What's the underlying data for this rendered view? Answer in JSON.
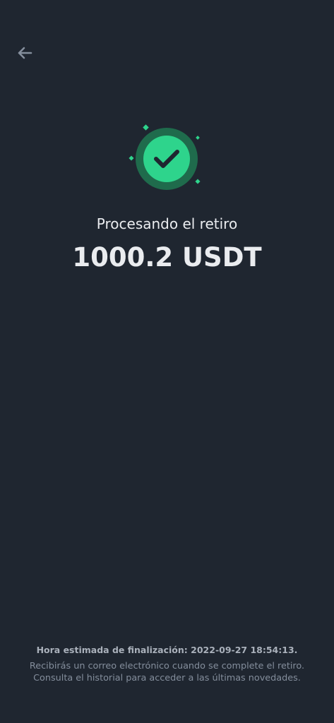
{
  "header": {
    "back_icon": "arrow-left-icon"
  },
  "status": {
    "icon": "check-circle-icon",
    "title": "Procesando el retiro",
    "amount": "1000.2 USDT",
    "accent_color": "#2ed48c"
  },
  "footer": {
    "eta_label": "Hora estimada de finalización:",
    "eta_value": "2022-09-27 18:54:13.",
    "note_line_1": "Recibirás un correo electrónico cuando se complete el retiro.",
    "note_line_2": "Consulta el historial para acceder a las últimas novedades."
  }
}
